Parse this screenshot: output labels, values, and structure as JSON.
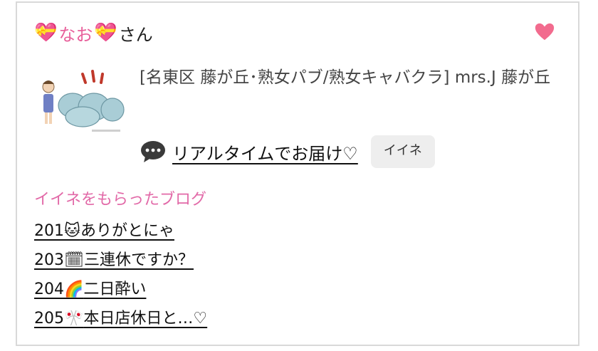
{
  "user": {
    "emoji": "💝",
    "name": "なお",
    "suffix": "さん"
  },
  "favorite": {
    "icon": "heart-icon",
    "color": "#f26b8e"
  },
  "shop": {
    "text": "[名東区 藤が丘･熟女パブ/熟女キャバクラ]  mrs.J 藤が丘"
  },
  "entry": {
    "icon": "speech-bubble-icon",
    "title": "リアルタイムでお届け♡",
    "iine_label": "イイネ"
  },
  "liked_blogs": {
    "title": "イイネをもらったブログ",
    "items": [
      {
        "num": "201",
        "emoji": "🐱",
        "title": "ありがとにゃ"
      },
      {
        "num": "203",
        "emoji": "🗓",
        "title": "三連休ですか？"
      },
      {
        "num": "204",
        "emoji": "🌈",
        "title": "二日酔い"
      },
      {
        "num": "205",
        "emoji": "🎌",
        "title": "本日店休日と…♡"
      }
    ]
  },
  "colors": {
    "accent_pink": "#e8609b",
    "section_pink": "#e26aa8",
    "border": "#d9d9d9"
  }
}
